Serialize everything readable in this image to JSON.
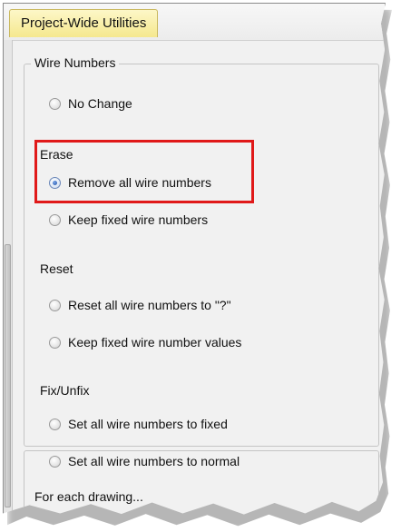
{
  "header": {
    "tab_label": "Project-Wide Utilities"
  },
  "wire_numbers": {
    "legend": "Wire Numbers",
    "no_change_label": "No Change",
    "erase": {
      "heading": "Erase",
      "options": [
        {
          "label": "Remove all wire numbers",
          "checked": true
        },
        {
          "label": "Keep fixed wire numbers",
          "checked": false
        }
      ]
    },
    "reset": {
      "heading": "Reset",
      "options": [
        {
          "label": "Reset all wire numbers to \"?\"",
          "checked": false
        },
        {
          "label": "Keep fixed wire number values",
          "checked": false
        }
      ]
    },
    "fix_unfix": {
      "heading": "Fix/Unfix",
      "options": [
        {
          "label": "Set all wire numbers to fixed",
          "checked": false
        },
        {
          "label": "Set all wire numbers to normal",
          "checked": false
        }
      ]
    }
  },
  "for_each_drawing": {
    "legend": "For each drawing..."
  },
  "highlight_color": "#e01919"
}
